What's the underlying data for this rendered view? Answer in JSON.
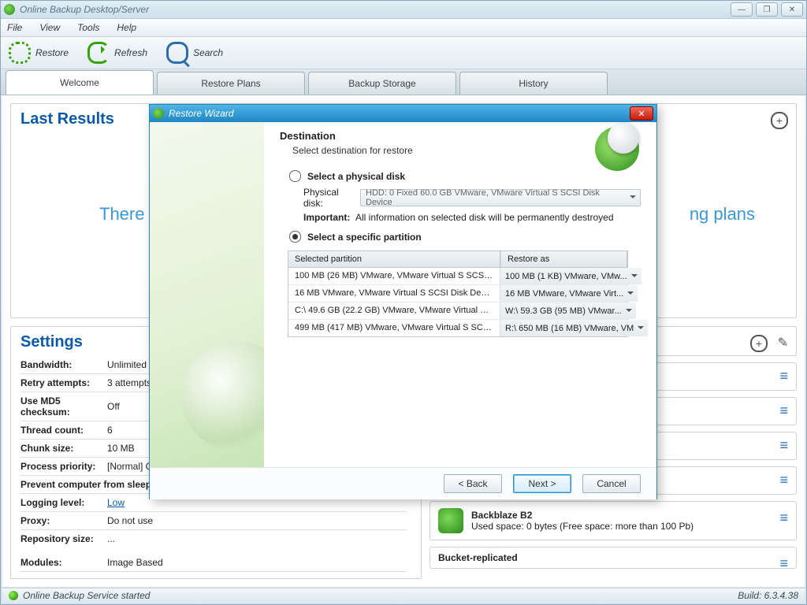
{
  "window": {
    "title": "Online Backup Desktop/Server"
  },
  "menu": {
    "file": "File",
    "view": "View",
    "tools": "Tools",
    "help": "Help"
  },
  "toolbar": {
    "restore": "Restore",
    "refresh": "Refresh",
    "search": "Search"
  },
  "tabs": {
    "welcome": "Welcome",
    "restore_plans": "Restore Plans",
    "backup_storage": "Backup Storage",
    "history": "History"
  },
  "last_results": {
    "heading": "Last Results",
    "placeholder_fragment_left": "There a",
    "placeholder_fragment_right": "ng plans"
  },
  "settings": {
    "heading": "Settings",
    "rows": {
      "bandwidth": {
        "label": "Bandwidth:",
        "value": "Unlimited"
      },
      "retry": {
        "label": "Retry attempts:",
        "value": "3  attempts,"
      },
      "md5": {
        "label": "Use MD5 checksum:",
        "value": "Off"
      },
      "threads": {
        "label": "Thread count:",
        "value": "6"
      },
      "chunk": {
        "label": "Chunk size:",
        "value": "10 MB"
      },
      "priority": {
        "label": "Process priority:",
        "value": "[Normal] Ge"
      },
      "sleep": {
        "label": "Prevent computer from sleeping",
        "value": ""
      },
      "logging": {
        "label": "Logging level:",
        "value": "Low"
      },
      "proxy": {
        "label": "Proxy:",
        "value": "Do not use"
      },
      "repo": {
        "label": "Repository size:",
        "value": "..."
      },
      "modules": {
        "label": "Modules:",
        "value": "Image Based"
      }
    }
  },
  "storage": {
    "backblaze": {
      "name": "Backblaze B2",
      "detail": "Used space: 0 bytes  (Free space: more than 100 Pb)"
    },
    "bucket": {
      "name": "Bucket-replicated"
    }
  },
  "statusbar": {
    "msg": "Online Backup Service started",
    "build": "Build: 6.3.4.38"
  },
  "wizard": {
    "title": "Restore Wizard",
    "heading": "Destination",
    "sub": "Select destination for restore",
    "opt_physical": "Select a physical disk",
    "physical_label": "Physical disk:",
    "physical_value": "HDD: 0 Fixed 60.0 GB VMware, VMware Virtual S SCSI Disk Device",
    "important_label": "Important:",
    "important_text": "All information on selected disk will be permanently destroyed",
    "opt_partition": "Select a specific partition",
    "col_selected": "Selected partition",
    "col_restore": "Restore as",
    "rows": [
      {
        "sel": "100 MB (26 MB) VMware, VMware Virtual S SCSI ...",
        "as": "100 MB (1 KB) VMware, VMw..."
      },
      {
        "sel": "16 MB VMware, VMware Virtual S SCSI Disk Device",
        "as": "16 MB VMware, VMware Virt..."
      },
      {
        "sel": "C:\\ 49.6 GB (22.2 GB) VMware, VMware Virtual S ...",
        "as": "W:\\ 59.3 GB (95 MB) VMwar..."
      },
      {
        "sel": "499 MB (417 MB) VMware, VMware Virtual S SCSI ...",
        "as": "R:\\ 650 MB (16 MB) VMware, VM"
      }
    ],
    "back": "< Back",
    "next": "Next >",
    "cancel": "Cancel"
  }
}
